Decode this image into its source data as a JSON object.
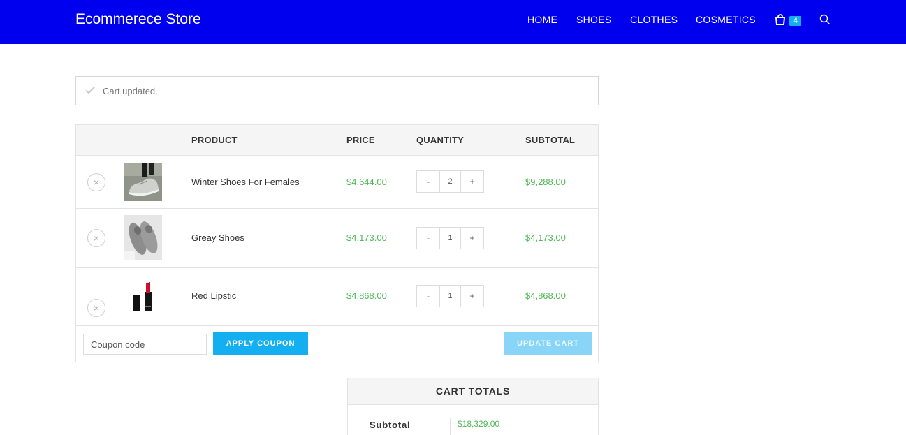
{
  "header": {
    "brand": "Ecommerece Store",
    "nav": [
      "HOME",
      "SHOES",
      "CLOTHES",
      "COSMETICS"
    ],
    "cart_count": "4",
    "cart_icon": "shopping-bag-icon",
    "search_icon": "search-icon",
    "bg_color": "#0000ee"
  },
  "notice": {
    "text": "Cart updated.",
    "icon": "check-icon"
  },
  "cart_table": {
    "headers": {
      "product": "PRODUCT",
      "price": "PRICE",
      "quantity": "QUANTITY",
      "subtotal": "SUBTOTAL"
    },
    "rows": [
      {
        "name": "Winter Shoes For Females",
        "price": "$4,644.00",
        "quantity": "2",
        "subtotal": "$9,288.00",
        "remove": "×",
        "minus": "-",
        "plus": "+"
      },
      {
        "name": "Greay Shoes",
        "price": "$4,173.00",
        "quantity": "1",
        "subtotal": "$4,173.00",
        "remove": "×",
        "minus": "-",
        "plus": "+"
      },
      {
        "name": "Red Lipstic",
        "price": "$4,868.00",
        "quantity": "1",
        "subtotal": "$4,868.00",
        "remove": "×",
        "minus": "-",
        "plus": "+"
      }
    ]
  },
  "actions": {
    "coupon_placeholder": "Coupon code",
    "apply_label": "APPLY COUPON",
    "update_label": "UPDATE CART"
  },
  "totals": {
    "title": "CART TOTALS",
    "subtotal_label": "Subtotal",
    "subtotal_value": "$18,329.00"
  },
  "colors": {
    "accent": "#13aff0",
    "price_green": "#52b858",
    "update_disabled": "#89d5f7"
  }
}
